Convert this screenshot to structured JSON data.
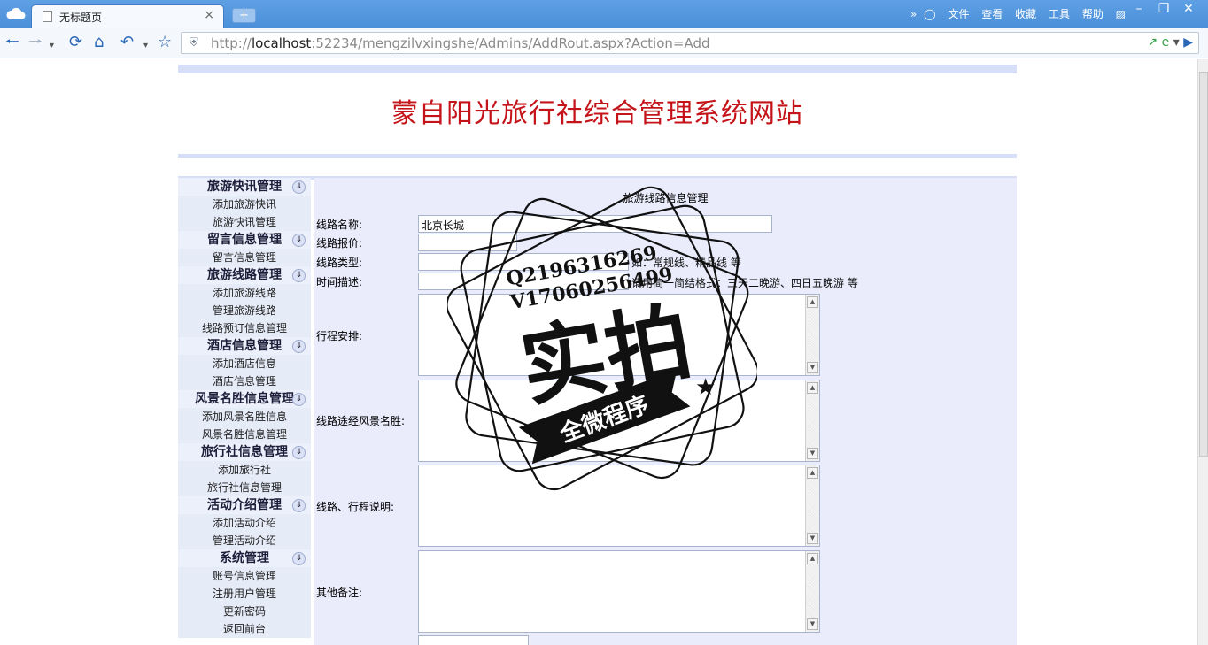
{
  "browser": {
    "tab_title": "无标题页",
    "new_tab_symbol": "+",
    "close_symbol": "×",
    "menus": [
      "文件",
      "查看",
      "收藏",
      "工具",
      "帮助"
    ],
    "more_symbol": "»",
    "url_prefix": "http://",
    "url_host": "localhost",
    "url_rest": ":52234/mengzilvxingshe/Admins/AddRout.aspx?Action=Add",
    "brand_color": "#4a8fd9"
  },
  "site": {
    "title": "蒙自阳光旅行社综合管理系统网站",
    "title_color": "#c4141a"
  },
  "sidebar": {
    "toggle_symbol": "»",
    "groups": [
      {
        "title": "旅游快讯管理",
        "items": [
          "添加旅游快讯",
          "旅游快讯管理"
        ]
      },
      {
        "title": "留言信息管理",
        "items": [
          "留言信息管理"
        ]
      },
      {
        "title": "旅游线路管理",
        "items": [
          "添加旅游线路",
          "管理旅游线路",
          "线路预订信息管理"
        ]
      },
      {
        "title": "酒店信息管理",
        "items": [
          "添加酒店信息",
          "酒店信息管理"
        ]
      },
      {
        "title": "风景名胜信息管理",
        "items": [
          "添加风景名胜信息",
          "风景名胜信息管理"
        ]
      },
      {
        "title": "旅行社信息管理",
        "items": [
          "添加旅行社",
          "旅行社信息管理"
        ]
      },
      {
        "title": "活动介绍管理",
        "items": [
          "添加活动介绍",
          "管理活动介绍"
        ]
      },
      {
        "title": "系统管理",
        "items": [
          "账号信息管理",
          "注册用户管理",
          "更新密码",
          "返回前台"
        ]
      }
    ]
  },
  "form": {
    "title": "旅游线路信息管理",
    "route_name_label": "线路名称:",
    "route_name_value": "北京长城",
    "price_label": "线路报价:",
    "price_value": "",
    "type_label": "线路类型:",
    "type_value": "",
    "type_hint": "如：常规线、精品线 等",
    "time_label": "时间描述:",
    "time_value": "",
    "time_hint": "请用简一简结格式：三天二晚游、四日五晚游 等",
    "itinerary_label": "行程安排:",
    "scenic_label": "线路途经风景名胜:",
    "notes_label": "线路、行程说明:",
    "other_label": "其他备注:"
  },
  "watermark": {
    "line1": "Q2196316269",
    "line2": "V17060256499",
    "big_text": "实拍",
    "ribbon_text": "全微程序"
  }
}
